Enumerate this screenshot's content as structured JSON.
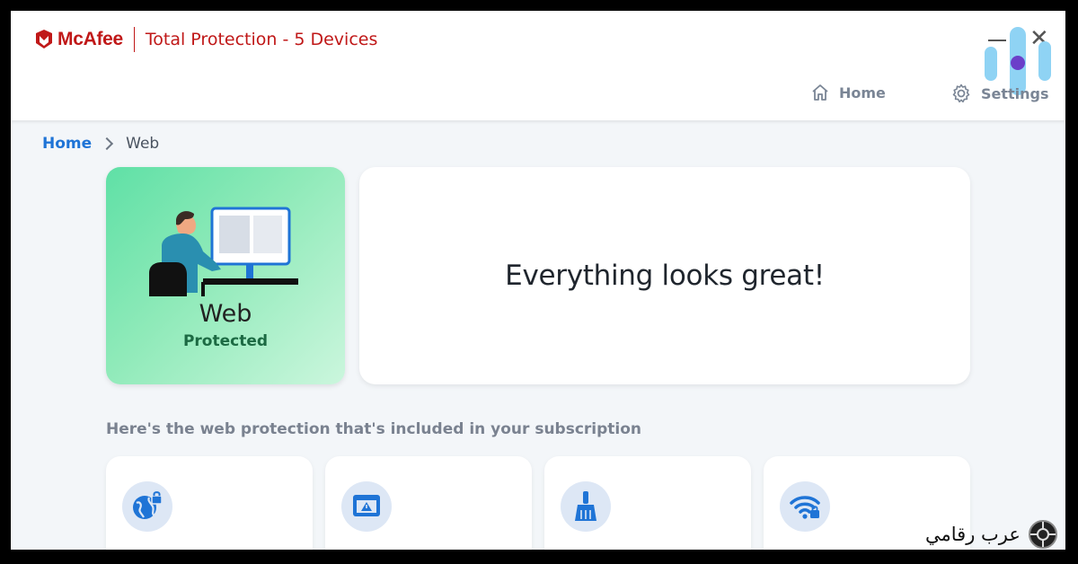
{
  "header": {
    "logo_text": "McAfee",
    "product_title": "Total Protection - 5 Devices",
    "nav": {
      "home": "Home",
      "settings": "Settings"
    }
  },
  "breadcrumb": {
    "home": "Home",
    "current": "Web"
  },
  "hero": {
    "title": "Web",
    "status": "Protected"
  },
  "status_message": "Everything looks great!",
  "section_title": "Here's the web protection that's included in your subscription",
  "features": [
    {
      "icon": "globe-lock-icon"
    },
    {
      "icon": "browser-alert-icon"
    },
    {
      "icon": "broom-icon"
    },
    {
      "icon": "wifi-lock-icon"
    }
  ],
  "watermark": {
    "text": "عرب رقامي"
  },
  "colors": {
    "brand_red": "#c01818",
    "link_blue": "#1f74d6",
    "icon_blue": "#1f74d6"
  }
}
